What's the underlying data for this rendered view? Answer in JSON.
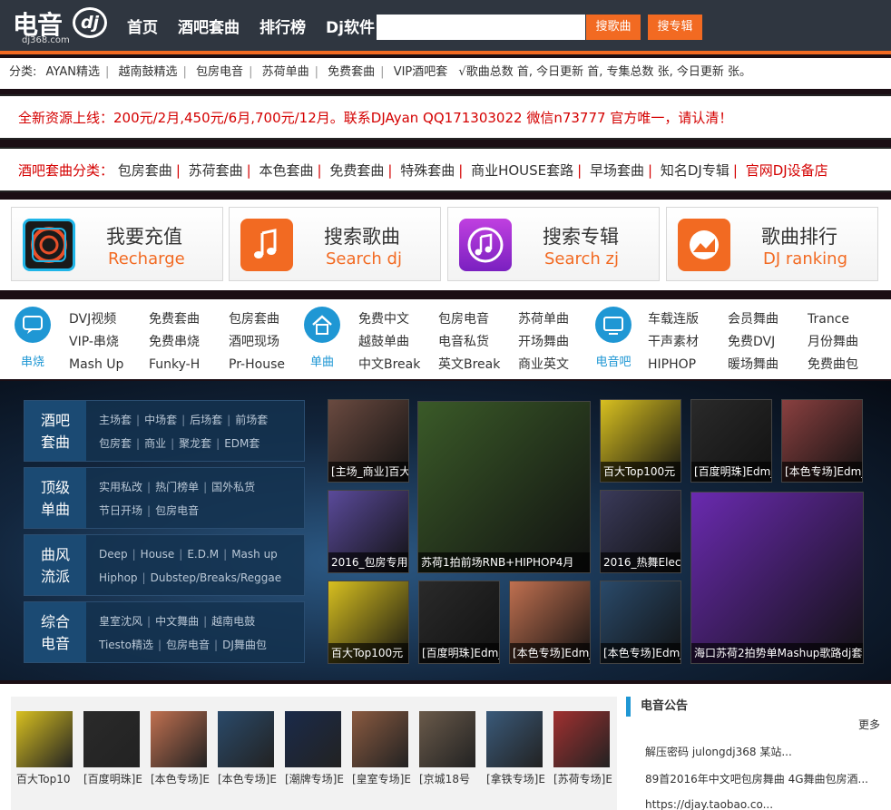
{
  "header": {
    "logo_text": "电音",
    "logo_dj": "dj",
    "logo_url": "dj368.com",
    "nav": [
      "首页",
      "酒吧套曲",
      "排行榜",
      "Dj软件"
    ],
    "search_placeholder": "",
    "search_song": "搜歌曲",
    "search_album": "搜专辑"
  },
  "category_bar": {
    "label": "分类:",
    "items": [
      "AYAN精选",
      "越南鼓精选",
      "包房电音",
      "苏荷单曲",
      "免费套曲",
      "VIP酒吧套"
    ],
    "stats": "√歌曲总数 首, 今日更新 首, 专集总数 张, 今日更新 张。"
  },
  "notice": "全新资源上线：200元/2月,450元/6月,700元/12月。联系DJAyan QQ171303022 微信n73777 官方唯一，请认清！",
  "set_categories": {
    "label": "酒吧套曲分类：",
    "items": [
      "包房套曲",
      "苏荷套曲",
      "本色套曲",
      "免费套曲",
      "特殊套曲",
      "商业HOUSE套路",
      "早场套曲",
      "知名DJ专辑"
    ],
    "last": "官网DJ设备店"
  },
  "quick_buttons": [
    {
      "title": "我要充值",
      "subtitle": "Recharge",
      "icon": "recharge-icon",
      "color": "#1a1a1a"
    },
    {
      "title": "搜索歌曲",
      "subtitle": "Search dj",
      "icon": "music-note-icon",
      "color": "#f26a22"
    },
    {
      "title": "搜索专辑",
      "subtitle": "Search zj",
      "icon": "album-icon",
      "color": "#9b2ad6"
    },
    {
      "title": "歌曲排行",
      "subtitle": "DJ ranking",
      "icon": "ranking-icon",
      "color": "#f26a22"
    }
  ],
  "quick_links": {
    "groups": [
      {
        "label": "串烧",
        "icon": "chat-bubble-icon",
        "cols": [
          [
            "DVJ视频",
            "VIP-串烧",
            "Mash Up"
          ],
          [
            "免费套曲",
            "免费串烧",
            "Funky-H"
          ],
          [
            "包房套曲",
            "酒吧现场",
            "Pr-House"
          ]
        ]
      },
      {
        "label": "单曲",
        "icon": "home-icon",
        "cols": [
          [
            "免费中文",
            "越鼓单曲",
            "中文Break"
          ],
          [
            "包房电音",
            "电音私货",
            "英文Break"
          ],
          [
            "苏荷单曲",
            "开场舞曲",
            "商业英文"
          ]
        ]
      },
      {
        "label": "电音吧",
        "icon": "monitor-icon",
        "cols": [
          [
            "车载连版",
            "干声素材",
            "HIPHOP"
          ],
          [
            "会员舞曲",
            "免费DVJ",
            "暖场舞曲"
          ],
          [
            "Trance",
            "月份舞曲",
            "免费曲包"
          ]
        ]
      }
    ]
  },
  "side_menu": [
    {
      "label": [
        "酒吧",
        "套曲"
      ],
      "rows": [
        [
          "主场套",
          "中场套",
          "后场套",
          "前场套"
        ],
        [
          "包房套",
          "商业",
          "聚龙套",
          "EDM套"
        ]
      ]
    },
    {
      "label": [
        "顶级",
        "单曲"
      ],
      "rows": [
        [
          "实用私改",
          "热门榜单",
          "国外私货"
        ],
        [
          "节日开场",
          "包房电音"
        ]
      ]
    },
    {
      "label": [
        "曲风",
        "流派"
      ],
      "rows": [
        [
          "Deep",
          "House",
          "E.D.M",
          "Mash up"
        ],
        [
          "Hiphop",
          "Dubstep/Breaks/Reggae"
        ]
      ]
    },
    {
      "label": [
        "综合",
        "电音"
      ],
      "rows": [
        [
          "皇室沈风",
          "中文舞曲",
          "越南电鼓"
        ],
        [
          "Tiesto精选",
          "包房电音",
          "DJ舞曲包"
        ]
      ]
    }
  ],
  "featured": [
    {
      "caption": "[主场_商业]百大",
      "color": "#6a4a40"
    },
    {
      "caption": "苏荷1拍前场RNB+HIPHOP4月",
      "color": "#3a5a28"
    },
    {
      "caption": "百大Top100元",
      "color": "#d8c020"
    },
    {
      "caption": "[百度明珠]Edm_",
      "color": "#2a2a2a"
    },
    {
      "caption": "[本色专场]Edm_",
      "color": "#8a4040"
    },
    {
      "caption": "2016_包房专用H",
      "color": "#5a4a9a"
    },
    {
      "caption": "2016_热舞Electr",
      "color": "#3a3a5a"
    },
    {
      "caption": "海口苏荷2拍势单Mashup歌路dj套",
      "color": "#6a2ab0"
    },
    {
      "caption": "百大Top100元",
      "color": "#d8c020"
    },
    {
      "caption": "[百度明珠]Edm_",
      "color": "#2a2a2a"
    },
    {
      "caption": "[本色专场]Edm_",
      "color": "#c07050"
    },
    {
      "caption": "[本色专场]Edm_",
      "color": "#2a4a6a"
    }
  ],
  "grid_items": [
    {
      "caption": "百大Top10",
      "color": "#d8c020"
    },
    {
      "caption": "[百度明珠]E",
      "color": "#2a2a2a"
    },
    {
      "caption": "[本色专场]E",
      "color": "#c07050"
    },
    {
      "caption": "[本色专场]E",
      "color": "#2a4a6a"
    },
    {
      "caption": "[潮牌专场]E",
      "color": "#1a2a4a"
    },
    {
      "caption": "[皇室专场]E",
      "color": "#8a5a40"
    },
    {
      "caption": "[京城18号",
      "color": "#6a5a4a"
    },
    {
      "caption": "[拿铁专场]E",
      "color": "#3a5a7a"
    },
    {
      "caption": "[苏荷专场]E",
      "color": "#a03030"
    }
  ],
  "announcements": {
    "title": "电音公告",
    "more": "更多",
    "items": [
      "解压密码 julongdj368 某站...",
      "89首2016年中文吧包房舞曲 4G舞曲包房酒...",
      "https://djay.taobao.co..."
    ]
  }
}
